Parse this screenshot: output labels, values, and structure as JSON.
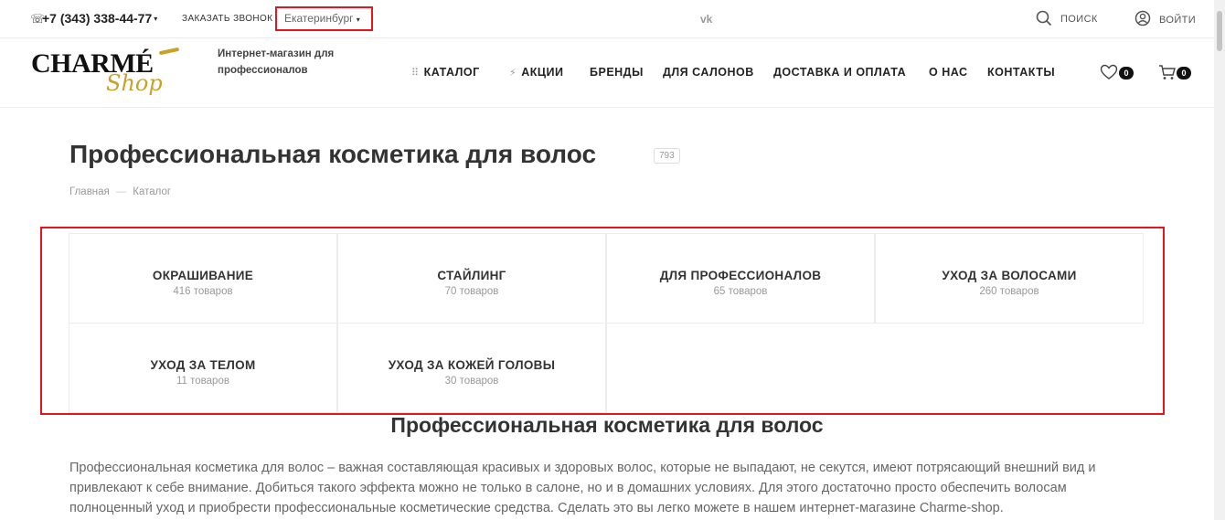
{
  "topbar": {
    "phone": "+7 (343) 338-44-77",
    "callback_label": "ЗАКАЗАТЬ ЗВОНОК",
    "city": "Екатеринбург",
    "vk_label": "vk",
    "search_label": "ПОИСК",
    "login_label": "ВОЙТИ"
  },
  "header": {
    "logo_main": "CHARMÉ",
    "logo_sub": "Shop",
    "tagline": "Интернет-магазин для профессионалов",
    "nav": [
      {
        "label": "КАТАЛОГ",
        "icon": "grid-icon"
      },
      {
        "label": "АКЦИИ",
        "icon": "lightning-icon"
      },
      {
        "label": "БРЕНДЫ"
      },
      {
        "label": "ДЛЯ САЛОНОВ"
      },
      {
        "label": "ДОСТАВКА И ОПЛАТА"
      },
      {
        "label": "О НАС"
      },
      {
        "label": "КОНТАКТЫ"
      }
    ],
    "favorites_count": "0",
    "cart_count": "0"
  },
  "page": {
    "title": "Профессиональная косметика для волос",
    "count": "793",
    "breadcrumb": [
      "Главная",
      "Каталог"
    ]
  },
  "categories": [
    {
      "name": "ОКРАШИВАНИЕ",
      "count": "416 товаров"
    },
    {
      "name": "СТАЙЛИНГ",
      "count": "70 товаров"
    },
    {
      "name": "ДЛЯ ПРОФЕССИОНАЛОВ",
      "count": "65 товаров"
    },
    {
      "name": "УХОД ЗА ВОЛОСАМИ",
      "count": "260 товаров"
    },
    {
      "name": "УХОД ЗА ТЕЛОМ",
      "count": "11 товаров"
    },
    {
      "name": "УХОД ЗА КОЖЕЙ ГОЛОВЫ",
      "count": "30 товаров"
    }
  ],
  "content": {
    "title": "Профессиональная косметика для волос",
    "text": "Профессиональная косметика для волос – важная составляющая красивых и здоровых волос, которые не выпадают, не секутся, имеют потрясающий внешний вид и привлекают к себе внимание. Добиться такого эффекта можно не только в салоне, но и в домашних условиях. Для этого достаточно просто обеспечить волосам полноценный уход и приобрести профессиональные косметические средства. Сделать это вы легко можете в нашем интернет-магазине Charme-shop."
  },
  "colors": {
    "highlight": "#e6151b",
    "logo_gold": "#c9a227",
    "text_dark": "#333333",
    "text_muted": "#999999"
  }
}
